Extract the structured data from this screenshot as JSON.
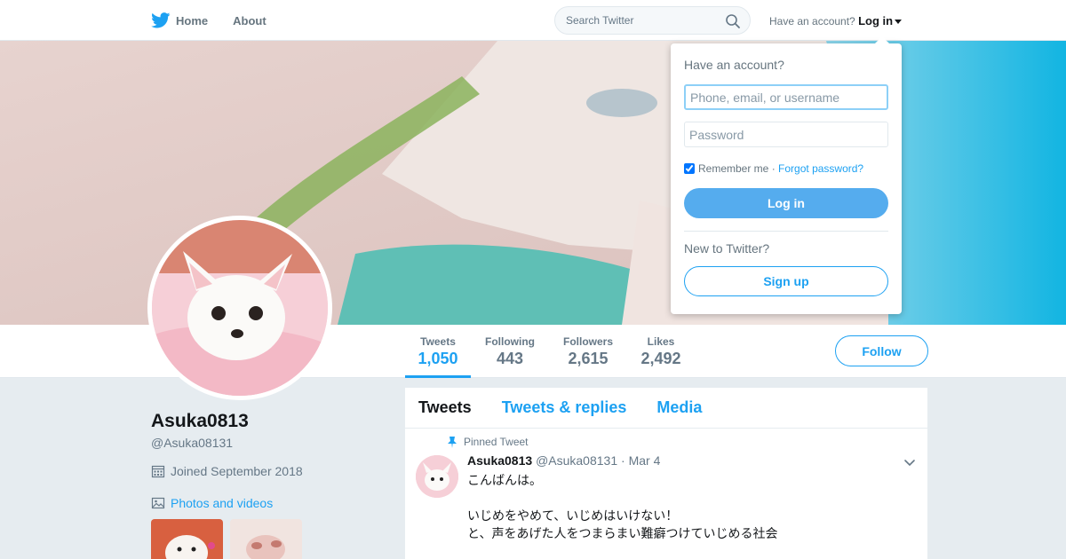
{
  "nav": {
    "home_label": "Home",
    "about_label": "About",
    "search_placeholder": "Search Twitter",
    "have_account": "Have an account?",
    "login_label": "Log in",
    "bird_icon": "twitter-bird-icon",
    "brand_color": "#1da1f2"
  },
  "login_dropdown": {
    "title": "Have an account?",
    "username_placeholder": "Phone, email, or username",
    "password_placeholder": "Password",
    "remember_label": "Remember me",
    "separator": "·",
    "forgot_label": "Forgot password?",
    "login_button": "Log in",
    "new_label": "New to Twitter?",
    "signup_button": "Sign up",
    "remember_checked": true
  },
  "profile": {
    "name": "Asuka0813",
    "handle": "@Asuka08131",
    "joined": "Joined September 2018",
    "photos_link": "Photos and videos",
    "follow_button": "Follow"
  },
  "stats": [
    {
      "label": "Tweets",
      "value": "1,050",
      "active": true
    },
    {
      "label": "Following",
      "value": "443",
      "active": false
    },
    {
      "label": "Followers",
      "value": "2,615",
      "active": false
    },
    {
      "label": "Likes",
      "value": "2,492",
      "active": false
    }
  ],
  "tabs": [
    {
      "label": "Tweets",
      "active": true
    },
    {
      "label": "Tweets & replies",
      "active": false
    },
    {
      "label": "Media",
      "active": false
    }
  ],
  "pinned_tweet": {
    "pinned_label": "Pinned Tweet",
    "name": "Asuka0813",
    "handle": "@Asuka08131",
    "date": "· Mar 4",
    "text": "こんばんは。\n\nいじめをやめて、いじめはいけない！\nと、声をあげた人をつまらまい難癖つけていじめる社会"
  }
}
